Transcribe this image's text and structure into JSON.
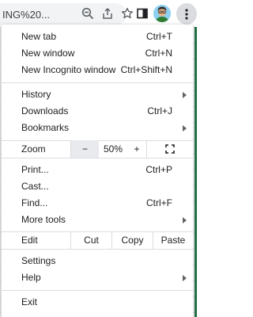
{
  "toolbar": {
    "url_text": "ING%20...",
    "icons": [
      "zoom-out-icon",
      "share-icon",
      "star-icon",
      "side-panel-icon",
      "avatar",
      "more-vert-icon"
    ]
  },
  "menu": {
    "new_tab": {
      "label": "New tab",
      "shortcut": "Ctrl+T"
    },
    "new_window": {
      "label": "New window",
      "shortcut": "Ctrl+N"
    },
    "new_incognito": {
      "label": "New Incognito window",
      "shortcut": "Ctrl+Shift+N"
    },
    "history": {
      "label": "History"
    },
    "downloads": {
      "label": "Downloads",
      "shortcut": "Ctrl+J"
    },
    "bookmarks": {
      "label": "Bookmarks"
    },
    "zoom": {
      "label": "Zoom",
      "minus": "−",
      "value": "50%",
      "plus": "+"
    },
    "print": {
      "label": "Print...",
      "shortcut": "Ctrl+P"
    },
    "cast": {
      "label": "Cast..."
    },
    "find": {
      "label": "Find...",
      "shortcut": "Ctrl+F"
    },
    "more_tools": {
      "label": "More tools"
    },
    "edit": {
      "label": "Edit",
      "cut": "Cut",
      "copy": "Copy",
      "paste": "Paste"
    },
    "settings": {
      "label": "Settings"
    },
    "help": {
      "label": "Help"
    },
    "exit": {
      "label": "Exit"
    }
  },
  "colors": {
    "menu_bg": "#ffffff",
    "separator": "#dadce0",
    "text": "#202124",
    "sheet_green": "#1e7145"
  }
}
